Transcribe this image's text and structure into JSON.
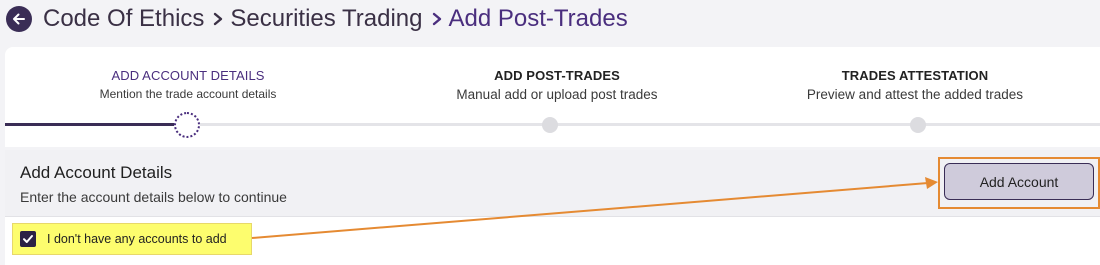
{
  "breadcrumb": {
    "items": [
      "Code Of Ethics",
      "Securities Trading",
      "Add Post-Trades"
    ]
  },
  "stepper": {
    "steps": [
      {
        "title": "ADD ACCOUNT DETAILS",
        "subtitle": "Mention the trade account details",
        "state": "active"
      },
      {
        "title": "ADD POST-TRADES",
        "subtitle": "Manual add or upload post trades",
        "state": "pending"
      },
      {
        "title": "TRADES ATTESTATION",
        "subtitle": "Preview and attest the added trades",
        "state": "pending"
      }
    ]
  },
  "details": {
    "title": "Add Account Details",
    "subtitle": "Enter the account details below to continue",
    "add_button_label": "Add Account",
    "no_accounts_label": "I don't have any accounts to add",
    "no_accounts_checked": true
  },
  "colors": {
    "brand": "#3a2d56",
    "accent_text": "#4a2e7e",
    "annotation": "#e58a32",
    "highlight": "#fdfd6e"
  },
  "icons": {
    "back": "arrow-left-circle-icon",
    "separator": "chevron-right-icon",
    "checkbox": "checkmark-icon"
  }
}
